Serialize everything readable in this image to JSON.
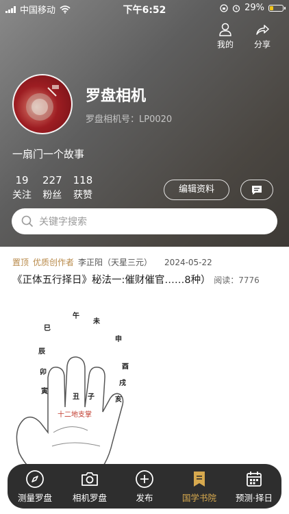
{
  "status_bar": {
    "carrier": "中国移动",
    "time": "下午6:52",
    "battery": "29%",
    "battery_level": 0.29
  },
  "top_actions": {
    "mine_label": "我的",
    "share_label": "分享"
  },
  "profile": {
    "name": "罗盘相机",
    "account_label": "罗盘相机号：LP0020",
    "bio": "一扇门一个故事"
  },
  "stats": [
    {
      "value": "19",
      "label": "关注"
    },
    {
      "value": "227",
      "label": "粉丝"
    },
    {
      "value": "118",
      "label": "获赞"
    }
  ],
  "actions": {
    "edit_label": "编辑资料"
  },
  "search": {
    "placeholder": "关键字搜索"
  },
  "article": {
    "pinned": "置顶",
    "badge": "优质创作者",
    "author": "李正阳（天星三元）",
    "date": "2024-05-22",
    "title": "《正体五行择日》秘法一:催财催官……8种）",
    "reads": "阅读：7776",
    "figure_text": {
      "caption": "十二地支掌",
      "zhi": [
        "午",
        "未",
        "巳",
        "申",
        "辰",
        "酉",
        "卯",
        "戌",
        "寅",
        "亥",
        "丑",
        "子"
      ]
    }
  },
  "bottom_nav": [
    {
      "label": "测量罗盘",
      "icon": "compass-icon"
    },
    {
      "label": "相机罗盘",
      "icon": "camera-icon"
    },
    {
      "label": "发布",
      "icon": "plus-circle-icon"
    },
    {
      "label": "国学书院",
      "icon": "bookmark-icon"
    },
    {
      "label": "预测·择日",
      "icon": "calendar-icon"
    }
  ],
  "colors": {
    "accent": "#d7a94e",
    "tag": "#b88a4a",
    "nav_bg": "#2e2e2e",
    "caption_red": "#c0392b"
  }
}
